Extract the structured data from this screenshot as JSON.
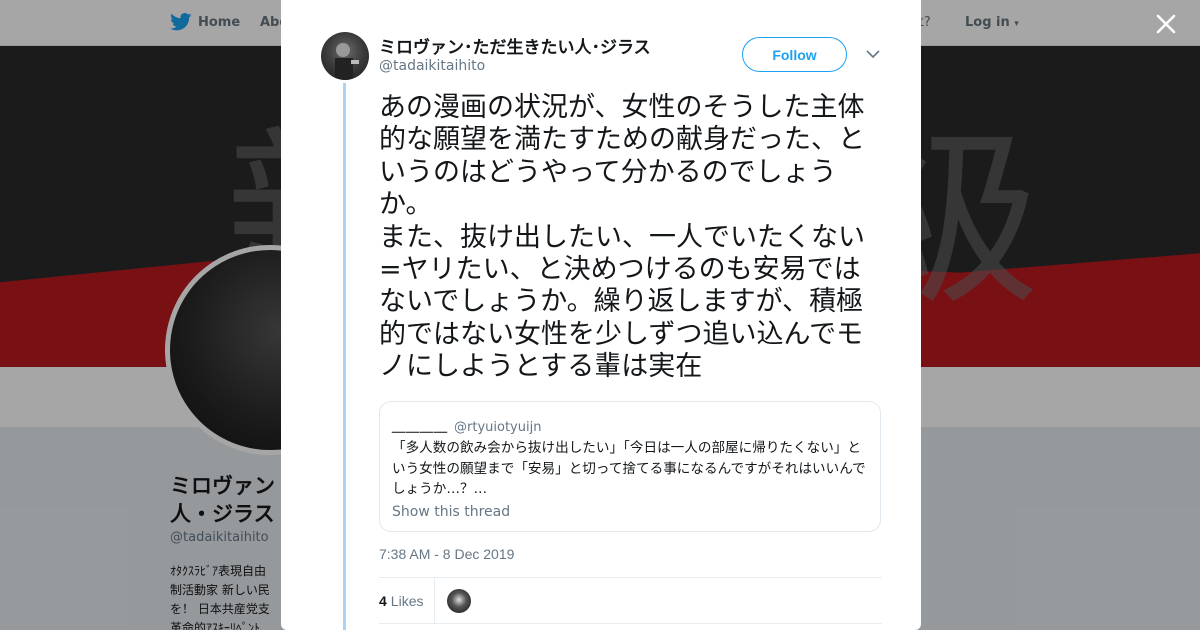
{
  "background_page": {
    "nav": {
      "home_label": "Home",
      "about_label": "Abo",
      "account_prompt": "ccount?",
      "login_label": "Log in"
    },
    "profile": {
      "name": "ミロヴァン・ただ生きたい人・ジラス",
      "name_visible_line1": "ミロヴァン",
      "name_visible_line2": "人・ジラス",
      "handle": "@tadaikitaihito",
      "bio_lines": [
        "ｵﾀｸｽﾗﾋﾞｱ表現自由",
        "制活動家 新しい民",
        "を！ 日本共産党支",
        "革命的ｱｽｷｰﾘﾍﾟﾝﾄ"
      ]
    }
  },
  "tweet": {
    "author": {
      "name": "ミロヴァン･ただ生きたい人･ジラス",
      "handle": "@tadaikitaihito"
    },
    "follow_label": "Follow",
    "text_paragraphs": [
      "あの漫画の状況が、女性のそうした主体的な願望を満たすための献身だった、というのはどうやって分かるのでしょうか。",
      "また、抜け出したい、一人でいたくない=ヤリたい、と決めつけるのも安易ではないでしょうか。繰り返しますが、積極的ではない女性を少しずつ追い込んでモノにしようとする輩は実在"
    ],
    "quoted": {
      "name": "＿＿＿＿",
      "handle": "@rtyuiotyuijn",
      "text": "「多人数の飲み会から抜け出したい」「今日は一人の部屋に帰りたくない」という女性の願望まで「安易」と切って捨てる事になるんですがそれはいいんでしょうか…？…",
      "show_thread_label": "Show this thread"
    },
    "timestamp": "7:38 AM - 8 Dec 2019",
    "likes_count": "4",
    "likes_label": "Likes"
  },
  "icons": {
    "logo": "twitter-bird-icon",
    "close": "close-icon",
    "more": "chevron-down-icon"
  },
  "colors": {
    "accent": "#1da1f2",
    "thread_line": "#aad4f5",
    "secondary_text": "#657786"
  }
}
